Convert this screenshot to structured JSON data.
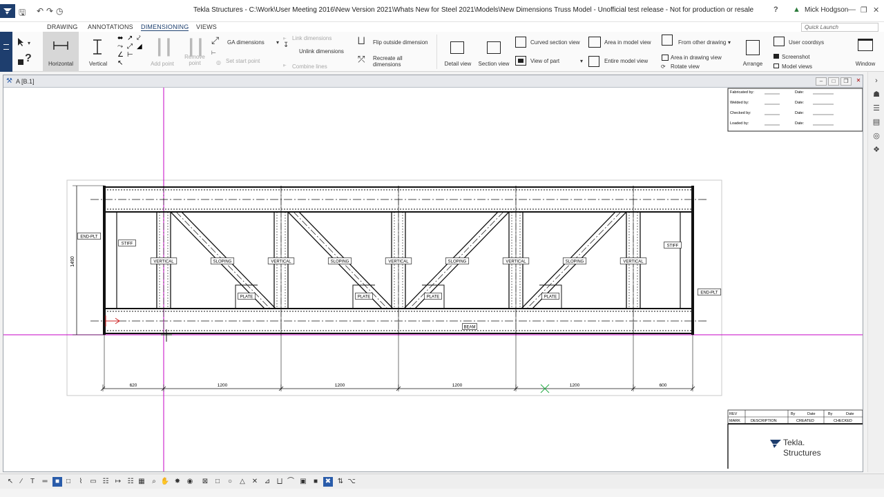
{
  "window": {
    "title": "Tekla Structures - C:\\Work\\User Meeting 2016\\New Version 2021\\Whats New for Steel 2021\\Models\\New Dimensions Truss Model  - Unofficial test release - Not for production or resale",
    "user": "Mick Hodgson",
    "help": "?",
    "minimize": "—",
    "restore": "❐",
    "close": "✕"
  },
  "ribbon": {
    "tabs": [
      "DRAWING",
      "ANNOTATIONS",
      "DIMENSIONING",
      "VIEWS"
    ],
    "active_tab": "DIMENSIONING",
    "quick_launch_placeholder": "Quick Launch",
    "buttons": {
      "horizontal": "Horizontal",
      "vertical": "Vertical",
      "add_point": "Add point",
      "remove_point": "Remove point",
      "ga_dimensions": "GA dimensions",
      "set_start_point": "Set start point",
      "link_dimensions": "Link dimensions",
      "unlink_dimensions": "Unlink dimensions",
      "combine_lines": "Combine lines",
      "flip_outside_dimension": "Flip outside dimension",
      "recreate_all_dimensions": "Recreate all dimensions",
      "detail_view": "Detail view",
      "section_view": "Section view",
      "curved_section_view": "Curved section view",
      "view_of_part": "View of part",
      "area_in_model_view": "Area in model view",
      "entire_model_view": "Entire model view",
      "from_other_drawing": "From other drawing",
      "area_in_drawing_view": "Area in drawing view",
      "rotate_view": "Rotate view",
      "arrange": "Arrange",
      "user_coordsys": "User coordsys",
      "screenshot": "Screenshot",
      "model_views": "Model views",
      "window": "Window"
    }
  },
  "drawing_window": {
    "title": "A   [B.1]"
  },
  "drawing": {
    "title_block_top": {
      "rows": [
        {
          "label": "Fabricated by:",
          "date": "Date:"
        },
        {
          "label": "Welded by:",
          "date": "Date:"
        },
        {
          "label": "Checked by:",
          "date": "Date:"
        },
        {
          "label": "Loaded by:",
          "date": "Date:"
        }
      ]
    },
    "title_block_bottom": {
      "rev": "REV",
      "mark": "MARK",
      "description": "DESCRIPTION",
      "by1": "By",
      "date1": "Date",
      "by2": "By",
      "date2": "Date",
      "created": "CREATED",
      "checked": "CHECKED",
      "brand_line1": "Tekla.",
      "brand_line2": "Structures"
    },
    "part_labels": {
      "end_plate_left": "END-PLT",
      "end_plate_right": "END-PLT",
      "stiff_left": "STIFF",
      "stiff_right": "STIFF",
      "vertical": "VERTICAL",
      "sloping": "SLOPING",
      "plate": "PLATE",
      "beam": "BEAM"
    },
    "height_dimension": "1490",
    "bottom_dimensions": [
      "620",
      "1200",
      "1200",
      "1200",
      "1200",
      "600"
    ]
  },
  "colors": {
    "ribbon_accent": "#1e3e6e",
    "cursor_line": "#c400c4",
    "origin_marker": "#cc2222",
    "snap_marker": "#22aa44"
  },
  "bottom_toolbar": {
    "icons": [
      "select-arrow-icon",
      "line-icon",
      "text-icon",
      "symbol-icon",
      "rectangle-icon",
      "square-icon",
      "polyline-icon",
      "box-icon",
      "grid-icon",
      "dimension-icon",
      "grid2-icon",
      "table-icon",
      "zoom-icon",
      "pan-icon",
      "snap-icon",
      "eye-icon",
      "snap-box-icon",
      "snap-square-icon",
      "snap-circle-icon",
      "snap-triangle-icon",
      "snap-cross-icon",
      "snap-perp-icon",
      "snap-line-icon",
      "snap-tangent-icon",
      "snap-mid-icon",
      "snap-free-icon",
      "snap-x-icon",
      "snap-flip-icon",
      "snap-more-icon"
    ]
  }
}
